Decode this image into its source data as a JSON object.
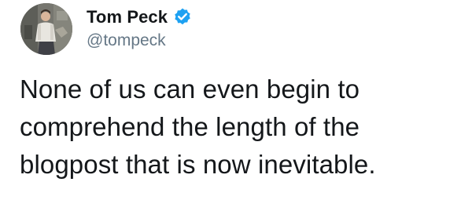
{
  "author": {
    "display_name": "Tom Peck",
    "handle": "@tompeck",
    "verified": true,
    "verified_icon": "verified-badge-icon",
    "verified_color": "#1da1f2"
  },
  "tweet": {
    "lines": [
      "None of us can even begin to",
      "comprehend the length of the",
      "blogpost that is now inevitable."
    ]
  }
}
